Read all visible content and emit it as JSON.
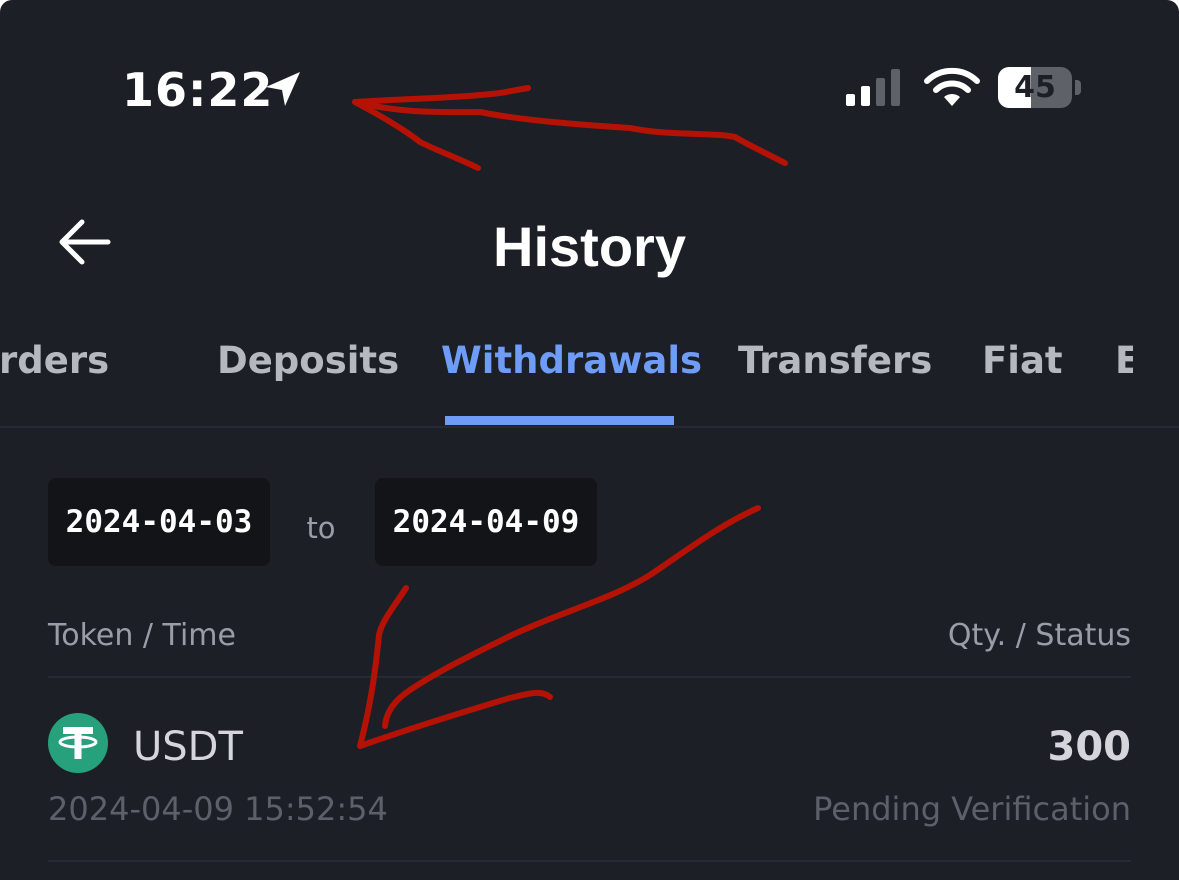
{
  "status_bar": {
    "time": "16:22",
    "battery": "45",
    "battery_level": 0.45,
    "icons": [
      "location-arrow-icon",
      "cellular-signal-icon",
      "wifi-icon",
      "battery-icon"
    ]
  },
  "header": {
    "back_icon": "arrow-left-icon",
    "title": "History"
  },
  "tabs": [
    {
      "label": "Orders",
      "visible_text": "rders",
      "active": false
    },
    {
      "label": "Deposits",
      "active": false
    },
    {
      "label": "Withdrawals",
      "active": true
    },
    {
      "label": "Transfers",
      "active": false
    },
    {
      "label": "Fiat",
      "active": false
    },
    {
      "label": "E",
      "active": false
    }
  ],
  "date_range": {
    "start": "2024-04-03",
    "separator": "to",
    "end": "2024-04-09"
  },
  "list": {
    "columns": {
      "left": "Token / Time",
      "right": "Qty. / Status"
    },
    "rows": [
      {
        "token": "USDT",
        "token_icon": "tether-icon",
        "time": "2024-04-09 15:52:54",
        "qty": "300",
        "status": "Pending Verification"
      }
    ]
  },
  "colors": {
    "background": "#1c1f26",
    "accent": "#6e9cf7",
    "tether_green": "#26a17b",
    "annotation_red": "#b51206"
  }
}
